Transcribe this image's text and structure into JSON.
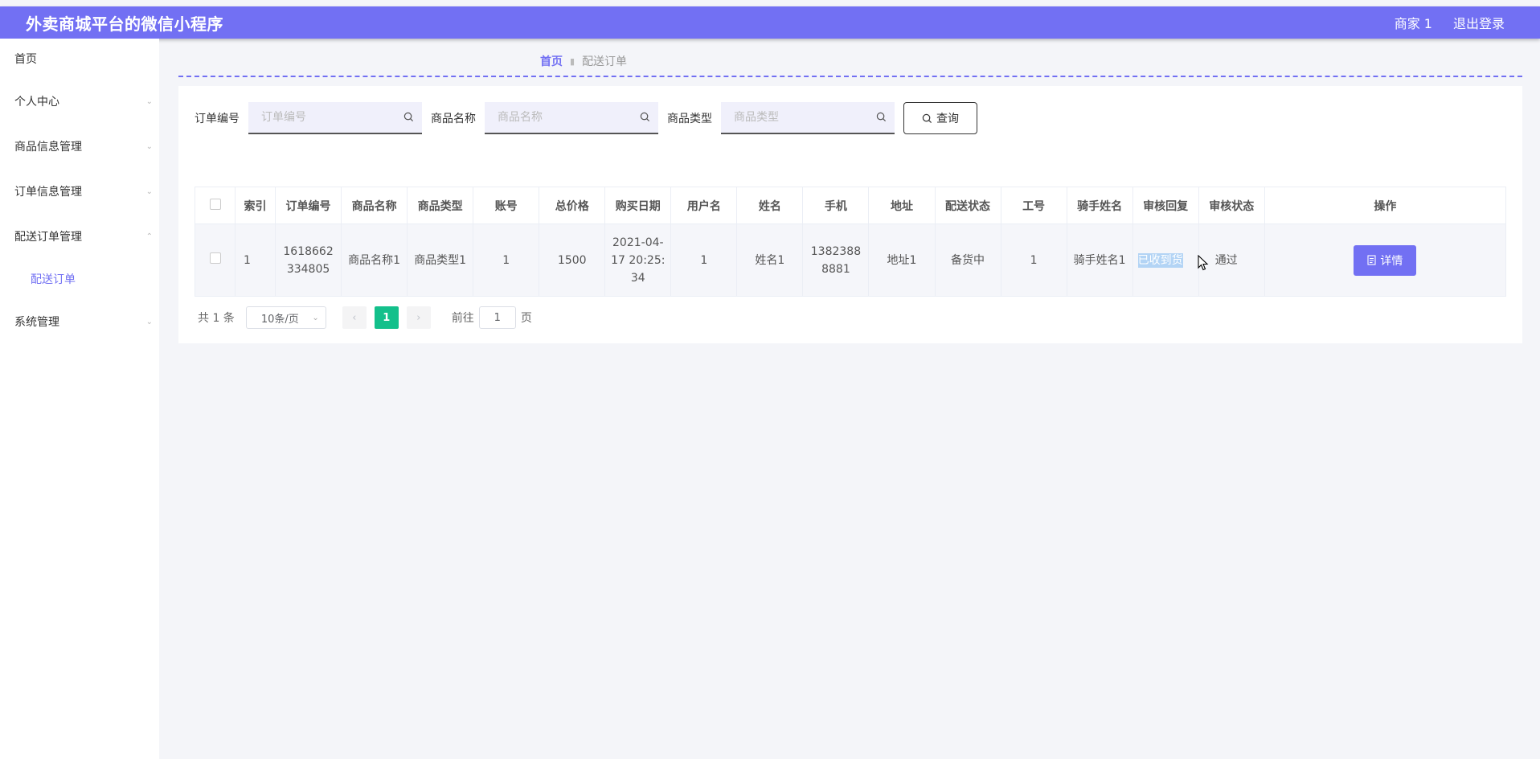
{
  "header": {
    "title": "外卖商城平台的微信小程序",
    "user": "商家 1",
    "logout": "退出登录"
  },
  "sidebar": {
    "items": [
      {
        "label": "首页",
        "has_children": false
      },
      {
        "label": "个人中心",
        "has_children": true
      },
      {
        "label": "商品信息管理",
        "has_children": true
      },
      {
        "label": "订单信息管理",
        "has_children": true
      },
      {
        "label": "配送订单管理",
        "has_children": true,
        "expanded": true
      },
      {
        "label": "系统管理",
        "has_children": true
      }
    ],
    "active_subitem": "配送订单"
  },
  "breadcrumb": {
    "home": "首页",
    "current": "配送订单"
  },
  "search": {
    "order_no_label": "订单编号",
    "order_no_placeholder": "订单编号",
    "product_name_label": "商品名称",
    "product_name_placeholder": "商品名称",
    "product_type_label": "商品类型",
    "product_type_placeholder": "商品类型",
    "query_button": "查询"
  },
  "table": {
    "columns": [
      "索引",
      "订单编号",
      "商品名称",
      "商品类型",
      "账号",
      "总价格",
      "购买日期",
      "用户名",
      "姓名",
      "手机",
      "地址",
      "配送状态",
      "工号",
      "骑手姓名",
      "审核回复",
      "审核状态",
      "操作"
    ],
    "rows": [
      {
        "index": "1",
        "order_no": "1618662334805",
        "product_name": "商品名称1",
        "product_type": "商品类型1",
        "account": "1",
        "total_price": "1500",
        "purchase_date": "2021-04-17 20:25:34",
        "username": "1",
        "name": "姓名1",
        "phone": "13823888881",
        "address": "地址1",
        "delivery_status": "备货中",
        "employee_no": "1",
        "rider_name": "骑手姓名1",
        "review_reply": "已收到货",
        "review_status": "通过",
        "action": "详情"
      }
    ]
  },
  "pagination": {
    "total": "共 1 条",
    "page_size": "10条/页",
    "current_page": "1",
    "goto_label": "前往",
    "goto_value": "1",
    "page_suffix": "页"
  },
  "colors": {
    "accent": "#7270f3",
    "pager_active": "#13c08b"
  }
}
